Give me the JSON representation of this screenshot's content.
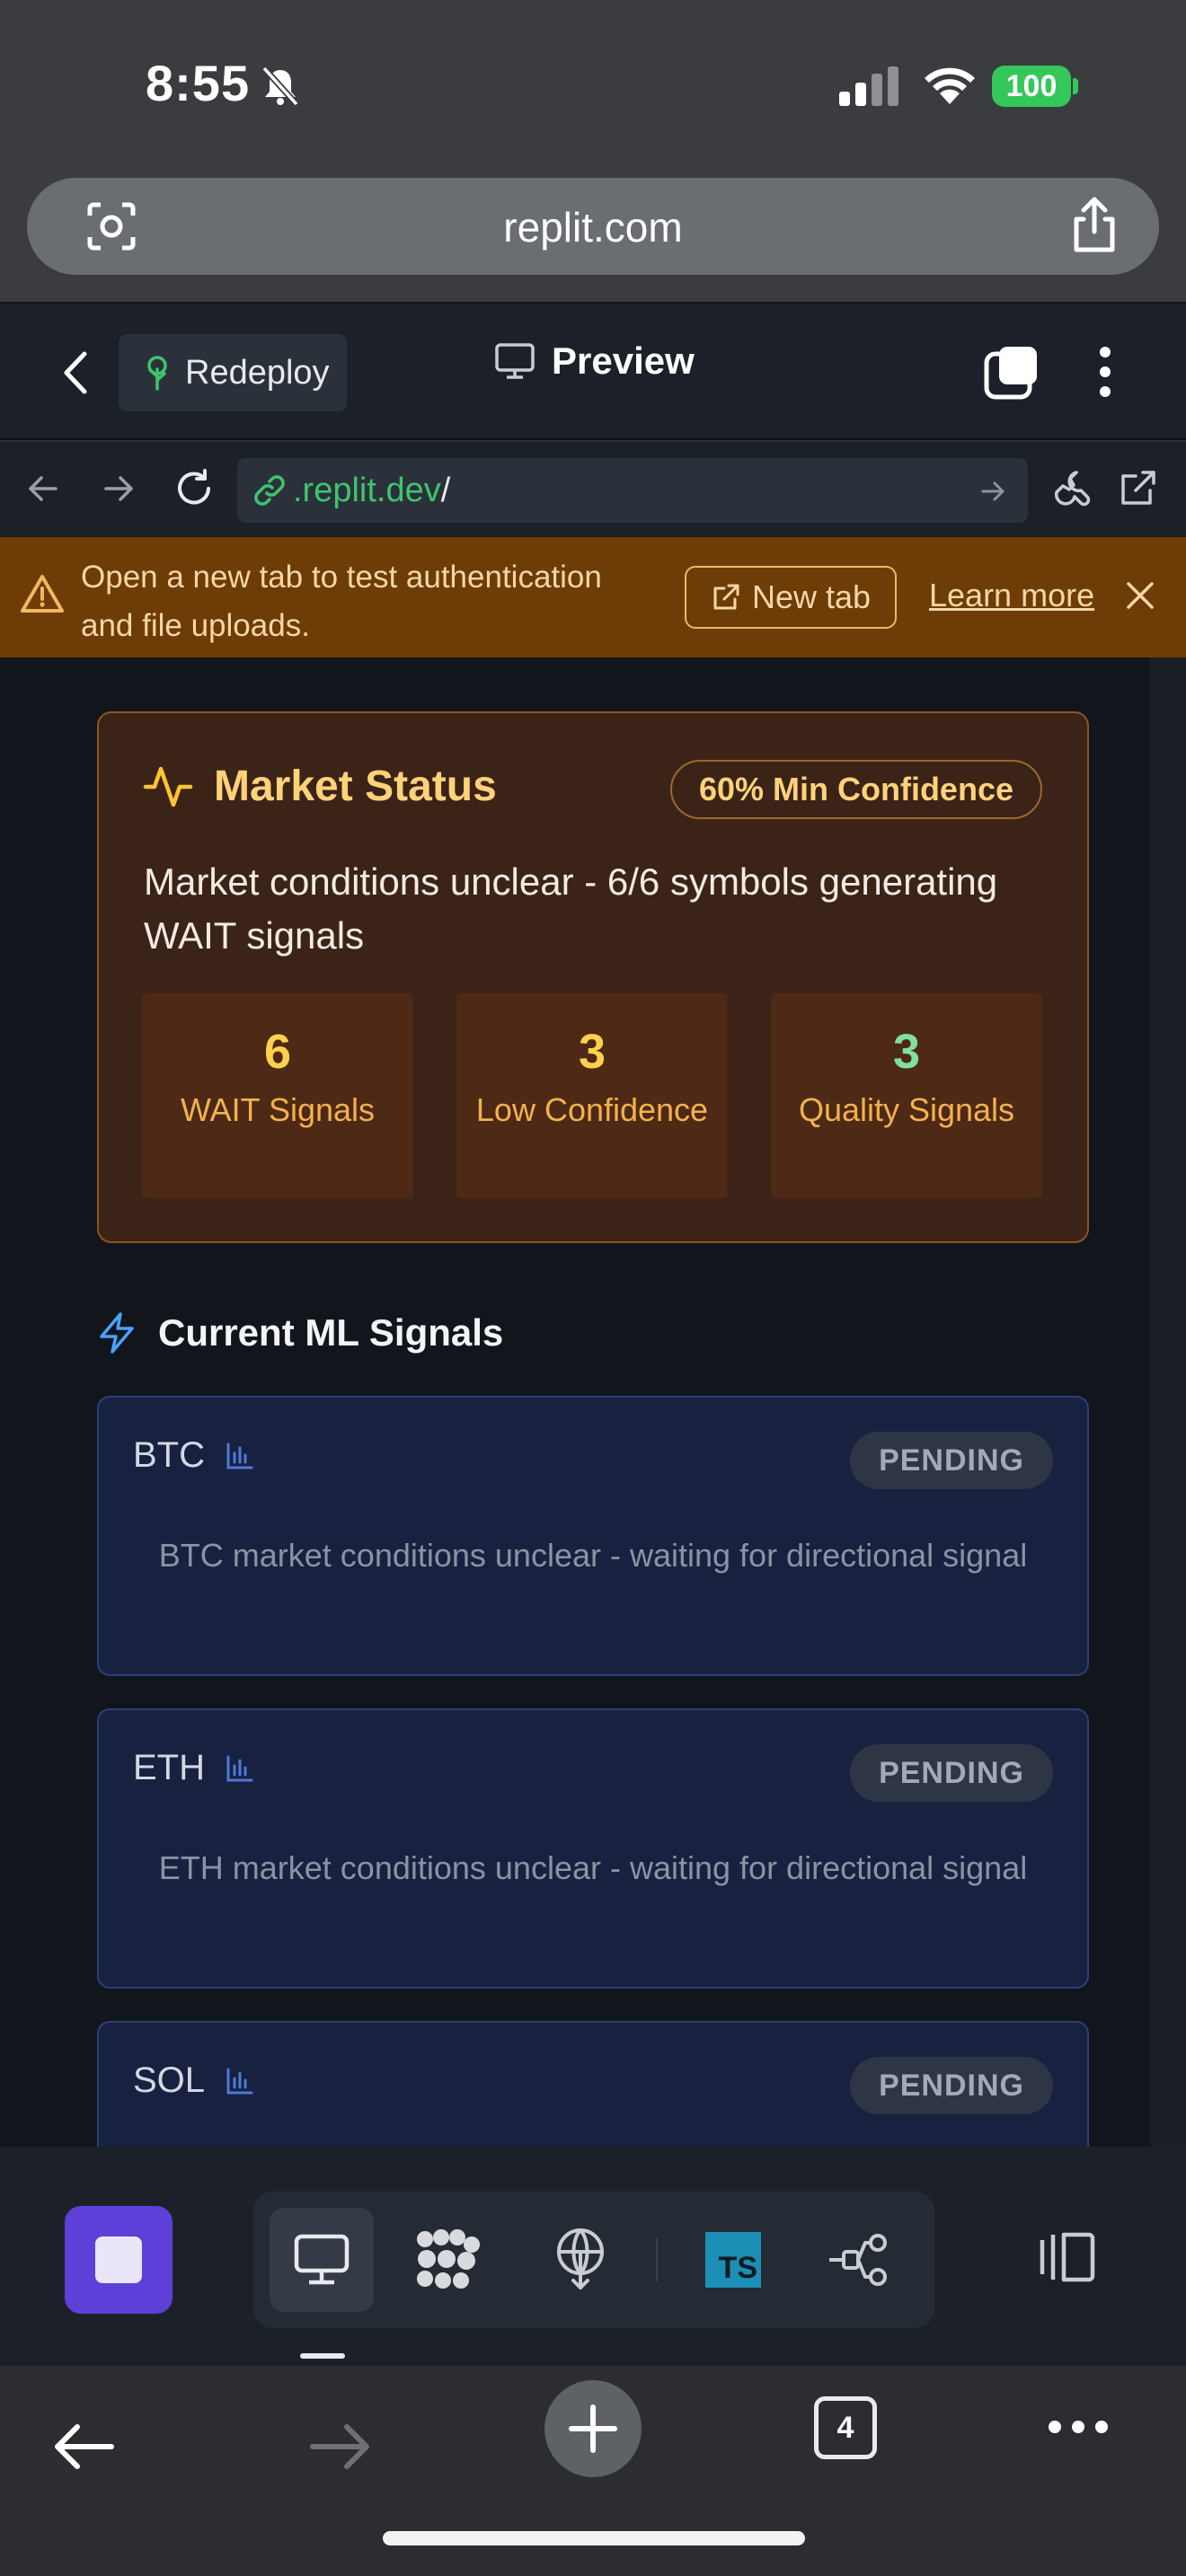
{
  "status_bar": {
    "time": "8:55",
    "battery": "100"
  },
  "safari": {
    "url": "replit.com",
    "open_tabs": "4"
  },
  "replit_bar": {
    "redeploy_label": "Redeploy",
    "preview_label": "Preview"
  },
  "browser_nav": {
    "address_domain": ".replit.dev",
    "address_path": "/"
  },
  "banner": {
    "message": "Open a new tab to test authentication and file uploads.",
    "new_tab_label": "New tab",
    "learn_more_label": "Learn more"
  },
  "market_status": {
    "title": "Market Status",
    "badge": "60% Min Confidence",
    "description": "Market conditions unclear - 6/6 symbols generating WAIT signals",
    "stats": [
      {
        "value": "6",
        "label": "WAIT Signals",
        "color": "#ffd24d"
      },
      {
        "value": "3",
        "label": "Low Confidence",
        "color": "#ffd24d"
      },
      {
        "value": "3",
        "label": "Quality Signals",
        "color": "#7fe0a0"
      }
    ]
  },
  "signals": {
    "heading": "Current ML Signals",
    "items": [
      {
        "symbol": "BTC",
        "status": "PENDING",
        "message": "BTC market conditions unclear - waiting for directional signal"
      },
      {
        "symbol": "ETH",
        "status": "PENDING",
        "message": "ETH market conditions unclear - waiting for directional signal"
      },
      {
        "symbol": "SOL",
        "status": "PENDING",
        "message": ""
      }
    ]
  },
  "colors": {
    "accent_purple": "#5e3fd8",
    "warning_bg": "#6e3c06",
    "market_card_bg": "#3c2318",
    "signal_card_bg": "#182140",
    "link_green": "#3ec46d"
  },
  "icons": [
    "bell-slash-icon",
    "cellular-icon",
    "wifi-icon",
    "lens-icon",
    "share-icon",
    "chevron-left-icon",
    "sprout-icon",
    "monitor-icon",
    "tabs-icon",
    "kebab-icon",
    "arrow-left-icon",
    "arrow-right-icon",
    "reload-icon",
    "link-icon",
    "wrench-icon",
    "external-link-icon",
    "warning-icon",
    "close-icon",
    "activity-icon",
    "lightning-icon",
    "bar-chart-icon",
    "stop-icon",
    "packages-icon",
    "deploy-icon",
    "typescript-icon",
    "git-icon",
    "panels-icon",
    "plus-icon",
    "more-icon"
  ]
}
